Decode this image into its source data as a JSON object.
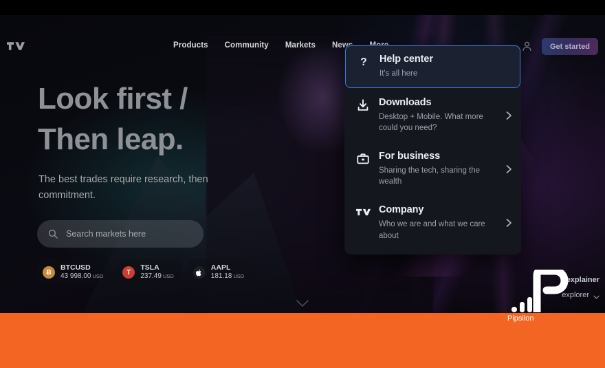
{
  "navbar": {
    "logo_icon": "tradingview-logo-icon",
    "links": [
      {
        "label": "Products"
      },
      {
        "label": "Community"
      },
      {
        "label": "Markets"
      },
      {
        "label": "News"
      },
      {
        "label": "More"
      }
    ],
    "profile_icon": "user-account-icon",
    "get_started_label": "Get started"
  },
  "hero": {
    "title": "Look first /\nThen leap.",
    "subtitle": "The best trades require research, then commitment.",
    "search": {
      "icon": "search-icon",
      "placeholder": "Search markets here",
      "value": ""
    },
    "tickers": [
      {
        "symbol": "BTCUSD",
        "price": "43 998.00",
        "currency": "USD",
        "badge": "Ƀ",
        "badge_color": "#c78a3e"
      },
      {
        "symbol": "TSLA",
        "price": "237.49",
        "currency": "USD",
        "badge": "T",
        "badge_color": "#cc3d33"
      },
      {
        "symbol": "AAPL",
        "price": "181.18",
        "currency": "USD",
        "badge": "",
        "badge_color": "#1c1f26"
      }
    ],
    "scroll_chevron_icon": "chevron-down-icon"
  },
  "dropdown": {
    "items": [
      {
        "title": "Help center",
        "description": "It's all here",
        "icon": "question-mark-icon",
        "has_arrow": false,
        "focused": true
      },
      {
        "title": "Downloads",
        "description": "Desktop + Mobile. What more could you need?",
        "icon": "download-icon",
        "has_arrow": true,
        "focused": false
      },
      {
        "title": "For business",
        "description": "Sharing the tech, sharing the wealth",
        "icon": "briefcase-icon",
        "has_arrow": true,
        "focused": false
      },
      {
        "title": "Company",
        "description": "Who we are and what we care about",
        "icon": "tradingview-logo-icon",
        "has_arrow": true,
        "focused": false
      }
    ],
    "arrow_icon": "chevron-right-icon",
    "focus_border_color": "#3b78d8",
    "background_color": "#15171f"
  },
  "bottom_right_widget": {
    "line1": "explainer",
    "line2": "explorer",
    "chevron_icon": "chevron-down-icon"
  },
  "watermark": {
    "label": "Pipsilon",
    "icon": "pipsilon-logo-icon"
  },
  "colors": {
    "orange_band": "#F26522",
    "accent_blue": "#3b78d8",
    "page_background": "#05060a"
  }
}
